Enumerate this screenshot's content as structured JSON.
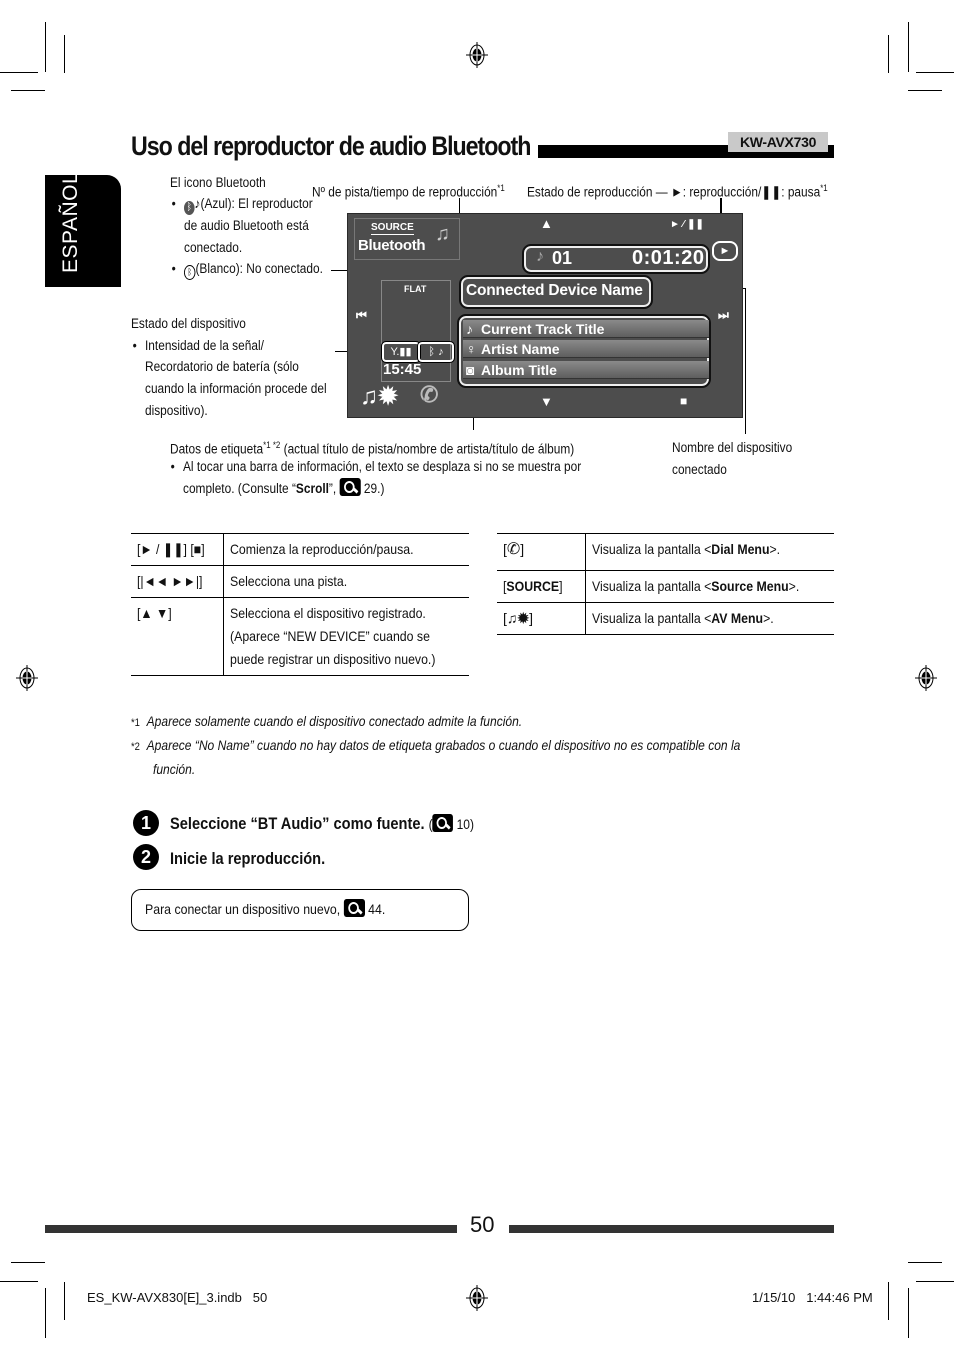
{
  "header": {
    "title": "Uso del reproductor de audio Bluetooth",
    "model_badge": "KW-AVX730",
    "language_tab": "ESPAÑOL"
  },
  "callouts": {
    "bt_icon_heading": "El icono Bluetooth",
    "bt_icon_blue": "(Azul): El reproductor",
    "bt_icon_blue_2": "de audio Bluetooth está",
    "bt_icon_blue_3": "conectado.",
    "bt_icon_white": "(Blanco): No conectado.",
    "track_time": "Nº de pista/tiempo de reproducción",
    "track_time_sup": "*1",
    "play_state": "Estado de reproducción — ►: reproducción/❚❚: pausa",
    "play_state_sup": "*1",
    "device_state_heading": "Estado del dispositivo",
    "device_state_1": "Intensidad de la señal/",
    "device_state_2": "Recordatorio de batería (sólo",
    "device_state_3": "cuando la información procede del",
    "device_state_4": "dispositivo).",
    "tag_data": "Datos de etiqueta",
    "tag_data_sup": "*1 *2",
    "tag_data_rest": " (actual título de pista/nombre de artista/título de álbum)",
    "tag_note_1": "Al tocar una barra de información, el texto se desplaza si no se muestra por",
    "tag_note_2a": "completo. (Consulte “",
    "tag_note_2b": "Scroll",
    "tag_note_2c": "”,",
    "tag_note_2d": " 29.)",
    "device_name_1": "Nombre del dispositivo",
    "device_name_2": "conectado"
  },
  "screen": {
    "source_label": "SOURCE",
    "source_value": "Bluetooth",
    "up_arrow": "▲",
    "down_arrow": "▼",
    "play_pause": "► ⁄ ❚❚",
    "play_state_icon": "►",
    "track_number": "01",
    "play_time": "0:01:20",
    "device_name": "Connected Device Name",
    "eq_mode": "FLAT",
    "prev": "⏮",
    "next": "⏭",
    "clock": "15:45",
    "track_title": "Current Track Title",
    "artist": "Artist Name",
    "album": "Album Title",
    "stop": "■"
  },
  "table_left": [
    {
      "key": "[► / ❚❚] [■]",
      "value": "Comienza la reproducción/pausa."
    },
    {
      "key": "[|◄◄ ►►|]",
      "value": "Selecciona una pista."
    },
    {
      "key": "[▲ ▼]",
      "value": "Selecciona el dispositivo registrado.",
      "value2": "(Aparece “NEW DEVICE” cuando se",
      "value3": "puede registrar un dispositivo nuevo.)"
    }
  ],
  "table_right": [
    {
      "key_icon": "phone-icon",
      "pre": "Visualiza la pantalla <",
      "bold": "Dial Menu",
      "post": ">."
    },
    {
      "key": "SOURCE",
      "pre": "Visualiza la pantalla <",
      "bold": "Source Menu",
      "post": ">."
    },
    {
      "key_icon": "av-menu-icon",
      "pre": "Visualiza la pantalla <",
      "bold": "AV Menu",
      "post": ">."
    }
  ],
  "footnotes": [
    {
      "mark": "*1",
      "text": "Aparece solamente cuando el dispositivo conectado admite la función."
    },
    {
      "mark": "*2",
      "text": "Aparece “No Name” cuando no hay datos de etiqueta grabados o cuando el dispositivo no es compatible con la",
      "text2": "función."
    }
  ],
  "steps": [
    {
      "num": "1",
      "text": "Seleccione “BT Audio” como fuente.",
      "ref": "10"
    },
    {
      "num": "2",
      "text": "Inicie la reproducción."
    }
  ],
  "info_box": {
    "text": "Para conectar un dispositivo nuevo,",
    "ref": "44."
  },
  "footer": {
    "page_number": "50",
    "file": "ES_KW-AVX830[E]_3.indb   50",
    "timestamp": "1/15/10   1:44:46 PM"
  }
}
